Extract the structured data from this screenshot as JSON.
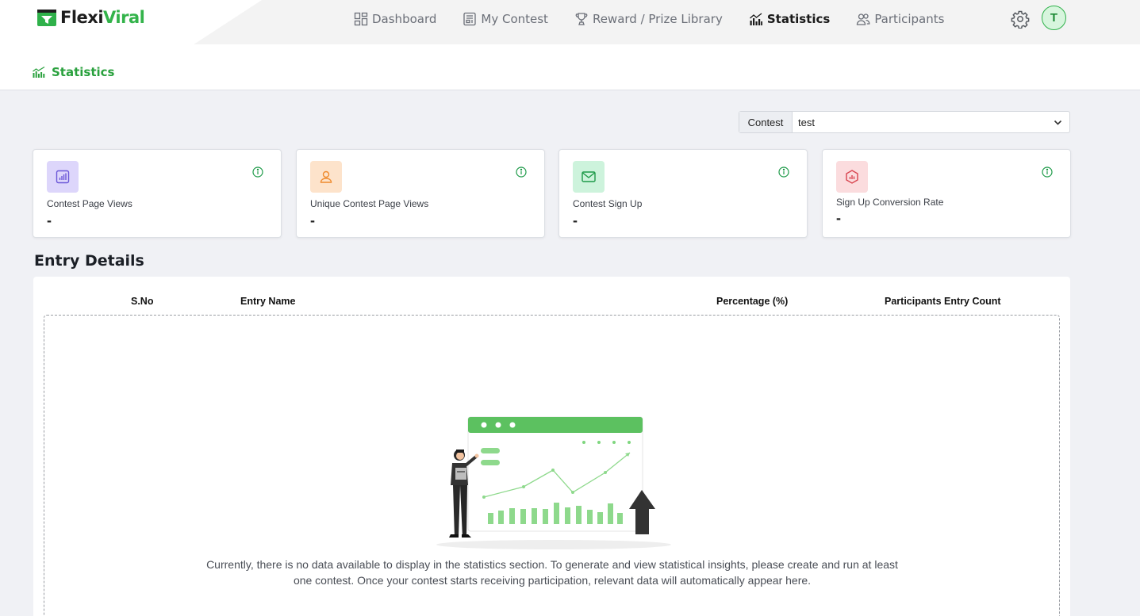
{
  "app": {
    "brand_part1": "Flexi",
    "brand_part2": "Viral",
    "brand_color": "#33b34a"
  },
  "nav": {
    "items": [
      {
        "label": "Dashboard",
        "icon": "dashboard-grid-icon"
      },
      {
        "label": "My Contest",
        "icon": "contest-list-icon"
      },
      {
        "label": "Reward / Prize Library",
        "icon": "trophy-icon"
      },
      {
        "label": "Statistics",
        "icon": "bar-chart-icon",
        "active": true
      },
      {
        "label": "Participants",
        "icon": "users-icon"
      }
    ],
    "settings_icon": "gear-icon",
    "avatar_initial": "T"
  },
  "breadcrumb": {
    "label": "Statistics",
    "icon": "bar-chart-icon"
  },
  "contest_filter": {
    "label": "Contest",
    "value": "test"
  },
  "cards": [
    {
      "title": "Contest Page Views",
      "value": "-",
      "icon": "page-views-chart-icon",
      "icon_bg": "#ddd6fb",
      "icon_color": "#6b57d8"
    },
    {
      "title": "Unique Contest Page Views",
      "value": "-",
      "icon": "user-icon",
      "icon_bg": "#fde3cb",
      "icon_color": "#ef8a2c"
    },
    {
      "title": "Contest Sign Up",
      "value": "-",
      "icon": "envelope-icon",
      "icon_bg": "#cdf3dc",
      "icon_color": "#1d9a48"
    },
    {
      "title": "Sign Up Conversion Rate",
      "value": "-",
      "icon": "conversion-hexagon-icon",
      "icon_bg": "#fbdcde",
      "icon_color": "#d8434e"
    }
  ],
  "entry_details": {
    "title": "Entry Details",
    "columns": [
      "S.No",
      "Entry Name",
      "Percentage (%)",
      "Participants Entry Count"
    ],
    "empty_message": "Currently, there is no data available to display in the statistics section. To generate and view statistical insights, please create and run at least one contest. Once your contest starts receiving participation, relevant data will automatically appear here."
  }
}
